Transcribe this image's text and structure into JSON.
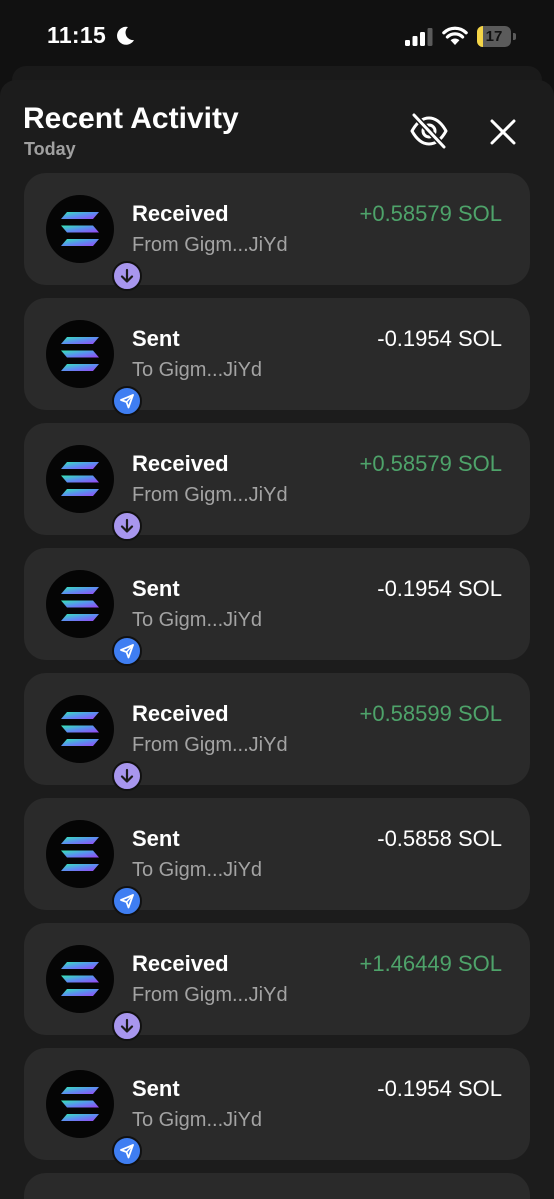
{
  "status_bar": {
    "time": "11:15",
    "battery_level": "17",
    "battery_fraction": 0.17,
    "icons": [
      "moon-icon",
      "signal-icon",
      "wifi-icon",
      "battery-icon"
    ]
  },
  "sheet": {
    "title": "Recent Activity",
    "subtitle": "Today",
    "icons": [
      "eye-slash-icon",
      "close-icon"
    ]
  },
  "colors": {
    "positive_amount": "#4ea36a",
    "received_badge": "#a896ee",
    "sent_badge": "#3f7ef2",
    "card": "#2a2a2a"
  },
  "activity": [
    {
      "type": "Received",
      "counterparty": "From Gigm...JiYd",
      "amount": "+0.58579 SOL",
      "direction": "received"
    },
    {
      "type": "Sent",
      "counterparty": "To Gigm...JiYd",
      "amount": "-0.1954 SOL",
      "direction": "sent"
    },
    {
      "type": "Received",
      "counterparty": "From Gigm...JiYd",
      "amount": "+0.58579 SOL",
      "direction": "received"
    },
    {
      "type": "Sent",
      "counterparty": "To Gigm...JiYd",
      "amount": "-0.1954 SOL",
      "direction": "sent"
    },
    {
      "type": "Received",
      "counterparty": "From Gigm...JiYd",
      "amount": "+0.58599 SOL",
      "direction": "received"
    },
    {
      "type": "Sent",
      "counterparty": "To Gigm...JiYd",
      "amount": "-0.5858 SOL",
      "direction": "sent"
    },
    {
      "type": "Received",
      "counterparty": "From Gigm...JiYd",
      "amount": "+1.46449 SOL",
      "direction": "received"
    },
    {
      "type": "Sent",
      "counterparty": "To Gigm...JiYd",
      "amount": "-0.1954 SOL",
      "direction": "sent"
    }
  ]
}
